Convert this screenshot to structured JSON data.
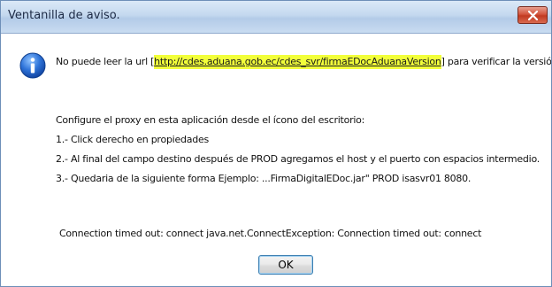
{
  "window": {
    "title": "Ventanilla de aviso.",
    "close_label": "x"
  },
  "message": {
    "prefix": "No puede leer la url [",
    "url": "http://cdes.aduana.gob.ec/cdes_svr/firmaEDocAduanaVersion",
    "suffix": "] para verificar la versión del Aplicativo."
  },
  "instructions": [
    "Configure el proxy en esta aplicación desde el ícono del escritorio:",
    "1.- Click derecho en propiedades",
    "2.- Al final del campo destino después de PROD agregamos el host y el puerto con espacios intermedio.",
    "3.- Quedaria de la siguiente forma Ejemplo: ...FirmaDigitalEDoc.jar\" PROD isasvr01 8080."
  ],
  "error": "Connection timed out: connect java.net.ConnectException: Connection timed out: connect",
  "ok_button": "OK",
  "icons": {
    "info": "info-icon",
    "close": "close-icon"
  },
  "colors": {
    "highlight": "#f2ff3a",
    "info_blue": "#1f5fc9",
    "close_red": "#c13a20"
  }
}
